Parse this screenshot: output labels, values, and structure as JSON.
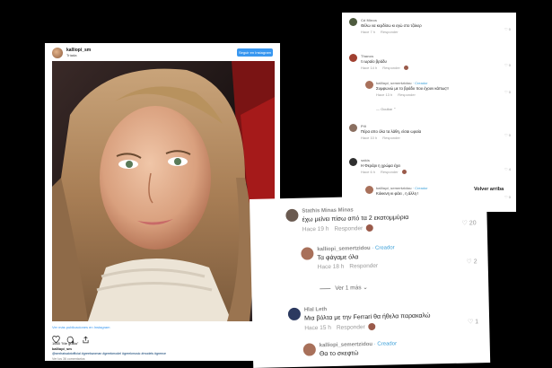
{
  "instagram": {
    "username": "kalliopi_sm",
    "location": "Tríada",
    "follow_label": "Seguir en Instagram",
    "view_more": "Ver más publicaciones en Instagram",
    "likes": "1665 \"Me gusta\"",
    "caption_user": "kalliopi_sm",
    "tags": "@sexhaisalotofficial #greekwoman #greekmodel #greekmusic #models #greece",
    "comments_link": "Ver los 36 comentarios"
  },
  "panel_a": {
    "comments": [
      {
        "name": "Cd Minos",
        "text": "Θέλω να κερδίσω κι εγώ στο τζόκερ",
        "time": "Hace 7 h",
        "reply": "Responder",
        "likes": "0",
        "avatar_color": "#4d5a3e"
      },
      {
        "name": "Thanos",
        "text": "τι ωραίο βράδυ",
        "time": "Hace 14 h",
        "reply": "Responder",
        "likes": "0",
        "avatar_color": "#a04030"
      },
      {
        "name": "kalliopi_semertzidou",
        "creator": "· Creador",
        "text": "Συμφωνώ με το βράδυ που έχουν κάπως!!",
        "time": "Hace 13 h",
        "reply": "Responder",
        "likes": "0",
        "avatar_color": "#a8705a",
        "is_reply": true
      },
      {
        "name": "Pili",
        "text": "Πέρα απο όλα τα λάθη, είσαι ωραία",
        "time": "Hace 10 h",
        "reply": "Responder",
        "likes": "0",
        "avatar_color": "#8a6f60"
      },
      {
        "name": "sakis",
        "text": "Η Φεράρι η χρώμα έχει",
        "time": "Hace 6 h",
        "reply": "Responder",
        "likes": "4",
        "avatar_color": "#2f2f2f"
      },
      {
        "name": "kalliopi_semertzidou",
        "creator": "· Creador",
        "text": "Κόκκινη κι φάει , η άλλη !",
        "time": "Hace 23 h",
        "reply": "Responder",
        "likes": "0",
        "avatar_color": "#a8705a",
        "is_reply": true
      }
    ],
    "more_replies": "Ocultar",
    "back": "Volver arriba"
  },
  "panel_b": {
    "comments": [
      {
        "name": "Stathis Minas Minas",
        "text": "έχω μείνει πίσω από τα 2 εκατομμύρια",
        "time": "Hace 19 h",
        "reply": "Responder",
        "likes": "20",
        "avatar_color": "#6a5a50"
      },
      {
        "name": "kalliopi_semertzidou",
        "creator": "· Creador",
        "text": "Τα φάγαμε όλα",
        "time": "Hace 18 h",
        "reply": "Responder",
        "likes": "2",
        "avatar_color": "#a8705a",
        "is_reply": true
      },
      {
        "name": "Hlal Leth",
        "text": "Μια βόλτα με την Ferrari θα ήθελα παρακαλώ",
        "time": "Hace 15 h",
        "reply": "Responder",
        "likes": "1",
        "avatar_color": "#2c3a60"
      },
      {
        "name": "kalliopi_semertzidou",
        "creator": "· Creador",
        "text": "Θα το σκεφτώ",
        "time": "",
        "reply": "",
        "likes": "",
        "avatar_color": "#a8705a",
        "is_reply": true
      }
    ],
    "more_replies": "Ver 1 más"
  }
}
